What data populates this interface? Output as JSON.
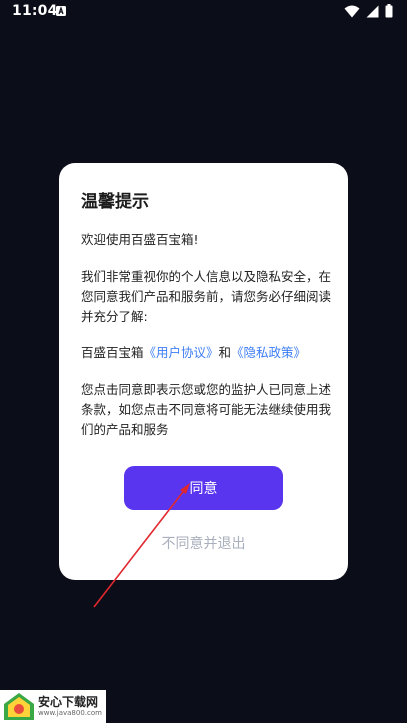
{
  "status_bar": {
    "time": "11:04",
    "app_icon": "a-notification-icon",
    "icons": [
      "wifi-icon",
      "signal-icon",
      "battery-icon"
    ]
  },
  "dialog": {
    "title": "温馨提示",
    "welcome": "欢迎使用百盛百宝箱!",
    "notice": "我们非常重视你的个人信息以及隐私安全，在您同意我们产品和服务前，请您务必仔细阅读并充分了解:",
    "links_prefix": "百盛百宝箱",
    "user_agreement": "《用户协议》",
    "links_conjunction": "和",
    "privacy_policy": "《隐私政策》",
    "consent": "您点击同意即表示您或您的监护人已同意上述条款，如您点击不同意将可能无法继续使用我们的产品和服务",
    "agree_label": "同意",
    "disagree_label": "不同意并退出"
  },
  "watermark": {
    "title": "安心下载网",
    "url": "www.java800.com"
  },
  "colors": {
    "background": "#0b0d18",
    "accent": "#5a35f0",
    "link": "#3d7ef5",
    "annotation_arrow": "#e0282e"
  }
}
